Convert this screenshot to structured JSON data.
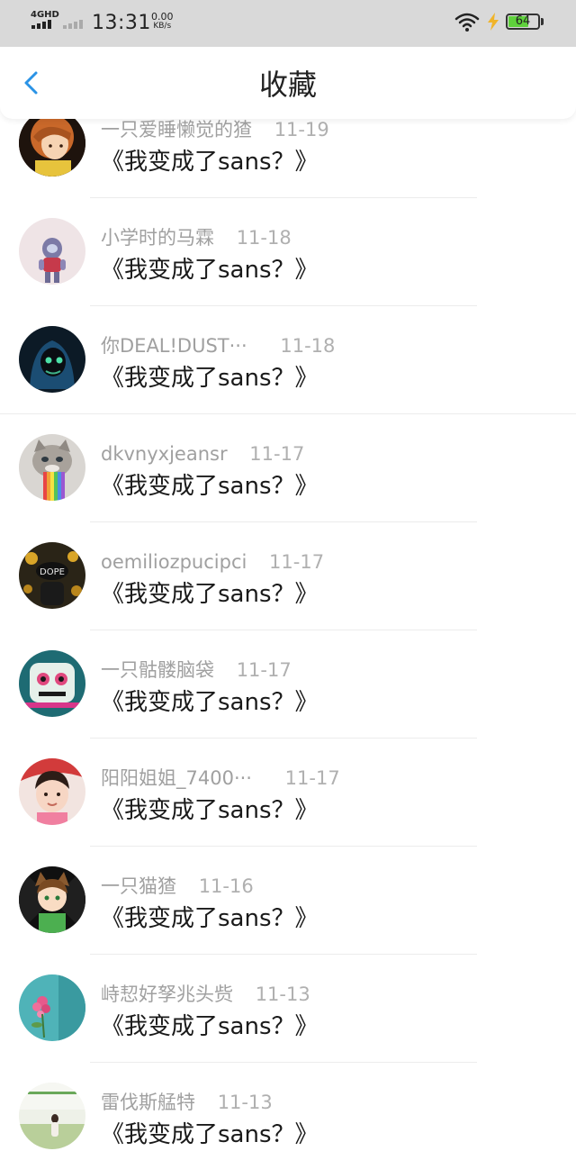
{
  "status_bar": {
    "network_label": "4GHD",
    "time": "13:31",
    "speed_value": "0.00",
    "speed_unit": "KB/s",
    "battery_level": "64",
    "battery_color": "#5fd13c",
    "icons": [
      "signal-icon",
      "wifi-icon",
      "charging-bolt-icon",
      "battery-icon"
    ]
  },
  "nav": {
    "back_icon": "chevron-left-icon",
    "title": "收藏",
    "accent_color": "#2a93e6"
  },
  "favorites": [
    {
      "name": "一只爱睡懒觉的猹",
      "time": "11-19",
      "title": "《我变成了sans？》"
    },
    {
      "name": "小学时的马霖",
      "time": "11-18",
      "title": "《我变成了sans？》"
    },
    {
      "name": "你DEAL!DUST···",
      "time": "11-18",
      "title": "《我变成了sans？》"
    },
    {
      "name": "dkvnyxjeansr",
      "time": "11-17",
      "title": "《我变成了sans？》"
    },
    {
      "name": "oemiliozpucipci",
      "time": "11-17",
      "title": "《我变成了sans？》"
    },
    {
      "name": "一只骷髅脑袋",
      "time": "11-17",
      "title": "《我变成了sans？》"
    },
    {
      "name": "阳阳姐姐_7400···",
      "time": "11-17",
      "title": "《我变成了sans？》"
    },
    {
      "name": "一只猫猹",
      "time": "11-16",
      "title": "《我变成了sans？》"
    },
    {
      "name": "峙恝好孥兆头赀",
      "time": "11-13",
      "title": "《我变成了sans？》"
    },
    {
      "name": "雷伐斯艋特",
      "time": "11-13",
      "title": "《我变成了sans？》"
    }
  ]
}
